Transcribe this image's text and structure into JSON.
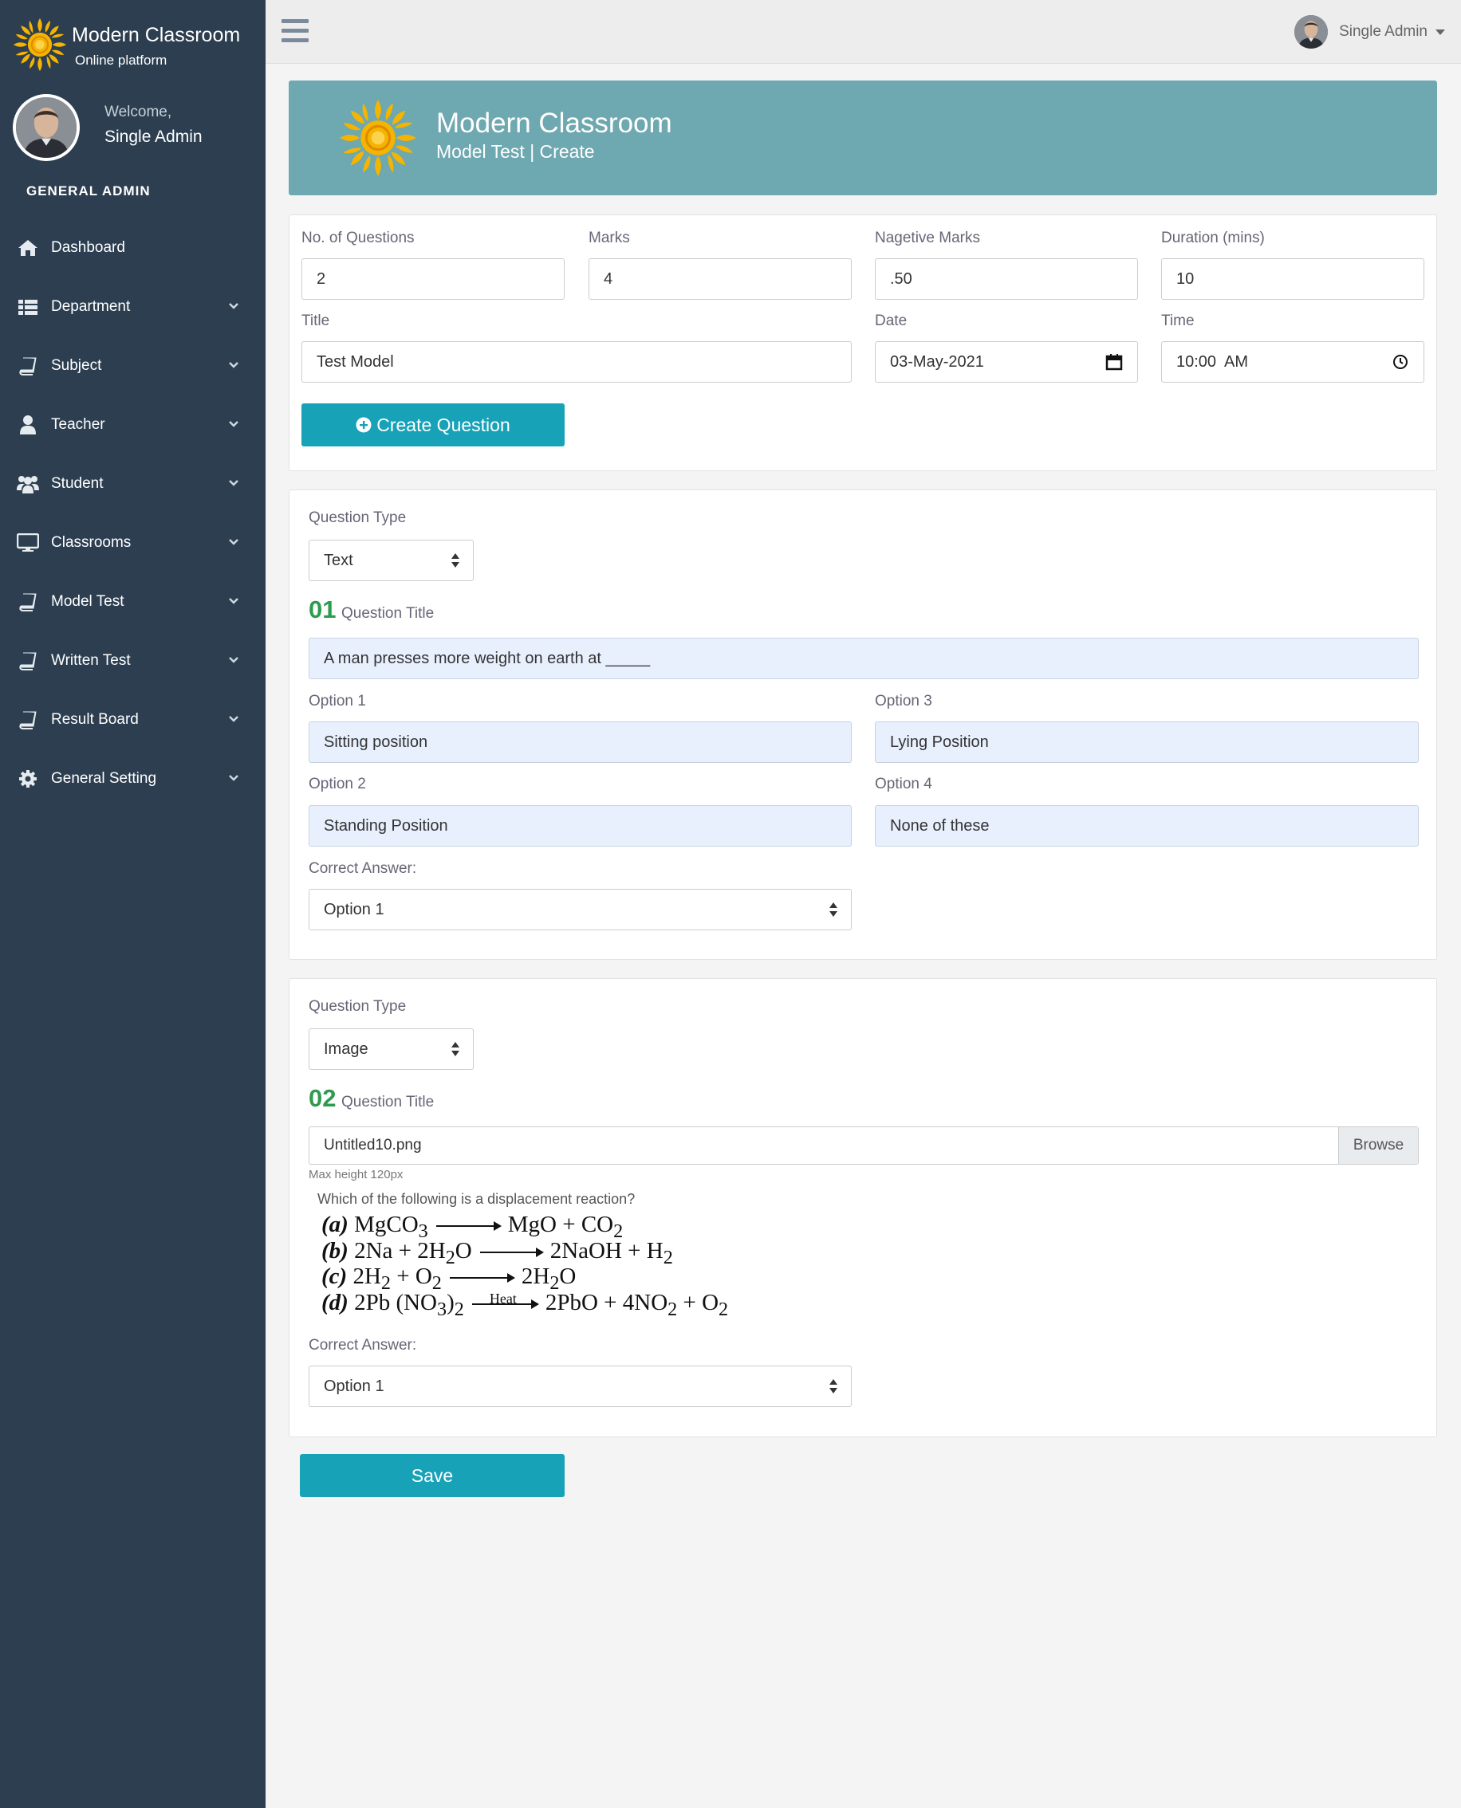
{
  "brand": {
    "name": "Modern Classroom",
    "tagline": "Online platform"
  },
  "profile": {
    "welcome": "Welcome,",
    "name": "Single Admin"
  },
  "sidebar": {
    "section": "GENERAL ADMIN",
    "items": [
      {
        "label": "Dashboard",
        "icon": "home-icon"
      },
      {
        "label": "Department",
        "icon": "table-icon"
      },
      {
        "label": "Subject",
        "icon": "book-icon"
      },
      {
        "label": "Teacher",
        "icon": "user-icon"
      },
      {
        "label": "Student",
        "icon": "users-icon"
      },
      {
        "label": "Classrooms",
        "icon": "desktop-icon"
      },
      {
        "label": "Model Test",
        "icon": "book-icon"
      },
      {
        "label": "Written Test",
        "icon": "book-icon"
      },
      {
        "label": "Result Board",
        "icon": "book-icon"
      },
      {
        "label": "General Setting",
        "icon": "gear-icon"
      }
    ]
  },
  "topbar": {
    "user": "Single Admin"
  },
  "header": {
    "title": "Modern Classroom",
    "subtitle": "Model Test | Create"
  },
  "form": {
    "num_questions": {
      "label": "No. of Questions",
      "value": "2"
    },
    "marks": {
      "label": "Marks",
      "value": "4"
    },
    "negative_marks": {
      "label": "Nagetive Marks",
      "value": ".50"
    },
    "duration": {
      "label": "Duration (mins)",
      "value": "10"
    },
    "title": {
      "label": "Title",
      "value": "Test Model"
    },
    "date": {
      "label": "Date",
      "value": "03-May-2021"
    },
    "time": {
      "label": "Time",
      "value": "10:00  AM"
    },
    "create_button": "Create Question"
  },
  "questions": [
    {
      "type_label": "Question Type",
      "type_value": "Text",
      "number": "01",
      "title_label": "Question Title",
      "title_value": "A man presses more weight on earth at _____",
      "options": [
        {
          "label": "Option 1",
          "value": "Sitting position"
        },
        {
          "label": "Option 2",
          "value": "Standing Position"
        },
        {
          "label": "Option 3",
          "value": "Lying Position"
        },
        {
          "label": "Option 4",
          "value": "None of these"
        }
      ],
      "answer_label": "Correct Answer:",
      "answer_value": "Option 1"
    },
    {
      "type_label": "Question Type",
      "type_value": "Image",
      "number": "02",
      "title_label": "Question Title",
      "file_name": "Untitled10.png",
      "browse_label": "Browse",
      "hint": "Max height 120px",
      "preview": {
        "caption": "Which of the following is a displacement reaction?",
        "lines": [
          {
            "label": "(a)",
            "left": "MgCO",
            "right": "MgO + CO"
          },
          {
            "label": "(b)",
            "left": "2Na + 2H",
            "right": "2NaOH + H"
          },
          {
            "label": "(c)",
            "left": "2H",
            "right": "2H"
          },
          {
            "label": "(d)",
            "left": "2Pb (NO",
            "right": "2PbO + 4NO",
            "arrow_text": "Heat"
          }
        ]
      },
      "answer_label": "Correct Answer:",
      "answer_value": "Option 1"
    }
  ],
  "save_button": "Save",
  "colors": {
    "sidebar": "#2c3e50",
    "banner": "#6ea8b0",
    "accent": "#17a2b8",
    "qnum": "#2e9b50"
  }
}
